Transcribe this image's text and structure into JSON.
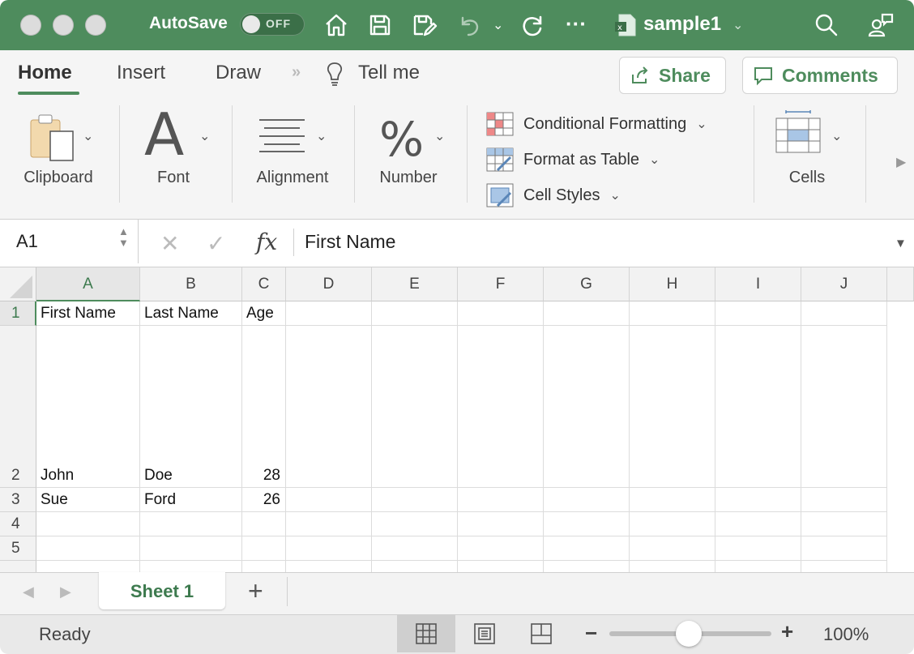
{
  "titlebar": {
    "autosave_label": "AutoSave",
    "autosave_state": "OFF",
    "doc_title": "sample1",
    "accent": "#4e8c5d"
  },
  "ribbon": {
    "tabs": [
      {
        "label": "Home",
        "active": true
      },
      {
        "label": "Insert"
      },
      {
        "label": "Draw"
      }
    ],
    "tell_me": "Tell me",
    "share_label": "Share",
    "comments_label": "Comments",
    "groups": {
      "clipboard": "Clipboard",
      "font": "Font",
      "alignment": "Alignment",
      "number": "Number",
      "cells": "Cells"
    },
    "styles": {
      "conditional_formatting": "Conditional Formatting",
      "format_as_table": "Format as Table",
      "cell_styles": "Cell Styles"
    }
  },
  "formula_bar": {
    "name_box": "A1",
    "formula": "First Name"
  },
  "grid": {
    "columns": [
      "A",
      "B",
      "C",
      "D",
      "E",
      "F",
      "G",
      "H",
      "I",
      "J"
    ],
    "rows": [
      {
        "num": "1",
        "cells": [
          "First Name",
          "Last Name",
          "Age"
        ]
      },
      {
        "num": "2",
        "cells": [
          "John",
          "Doe",
          "28"
        ]
      },
      {
        "num": "3",
        "cells": [
          "Sue",
          "Ford",
          "26"
        ]
      },
      {
        "num": "4",
        "cells": []
      },
      {
        "num": "5",
        "cells": []
      }
    ],
    "selected_cell": "A1"
  },
  "sheets": {
    "tabs": [
      "Sheet 1"
    ],
    "add_label": "+"
  },
  "status": {
    "text": "Ready",
    "zoom": "100%"
  }
}
